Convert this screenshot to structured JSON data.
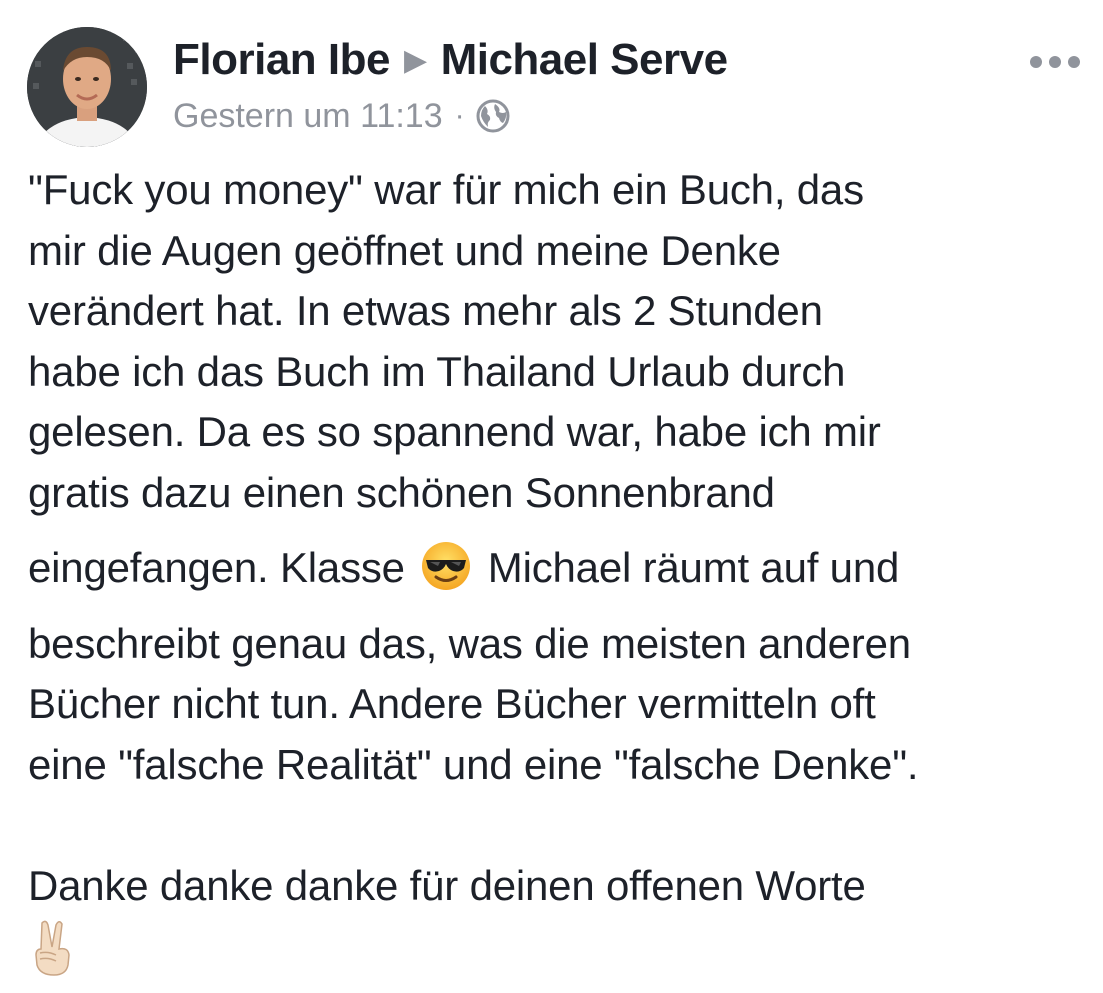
{
  "post": {
    "author": "Florian Ibe",
    "separator": "▶",
    "recipient": "Michael Serve",
    "timestamp": "Gestern um 11:13",
    "meta_separator": "·",
    "privacy_icon": "globe-icon",
    "more_icon": "more-options-icon",
    "lines": [
      "\"Fuck you money\" war für mich ein Buch, das",
      "mir die Augen geöffnet und meine Denke",
      "verändert hat. In etwas mehr als 2 Stunden",
      "habe ich das Buch im Thailand Urlaub durch",
      "gelesen. Da es so spannend war, habe ich mir",
      "gratis dazu einen schönen Sonnenbrand"
    ],
    "line7_before_emoji": "eingefangen. Klasse",
    "line7_emoji": "smiling-face-with-sunglasses-emoji",
    "line7_after_emoji": "Michael räumt auf und",
    "lines_after": [
      "beschreibt genau das, was die meisten anderen",
      "Bücher nicht tun. Andere Bücher vermitteln oft",
      "eine \"falsche Realität\" und eine \"falsche Denke\"."
    ],
    "closing_line": "Danke danke danke für deinen offenen Worte",
    "closing_emoji": "victory-hand-emoji"
  },
  "colors": {
    "text": "#1d2129",
    "secondary": "#90949c",
    "background": "#ffffff"
  }
}
